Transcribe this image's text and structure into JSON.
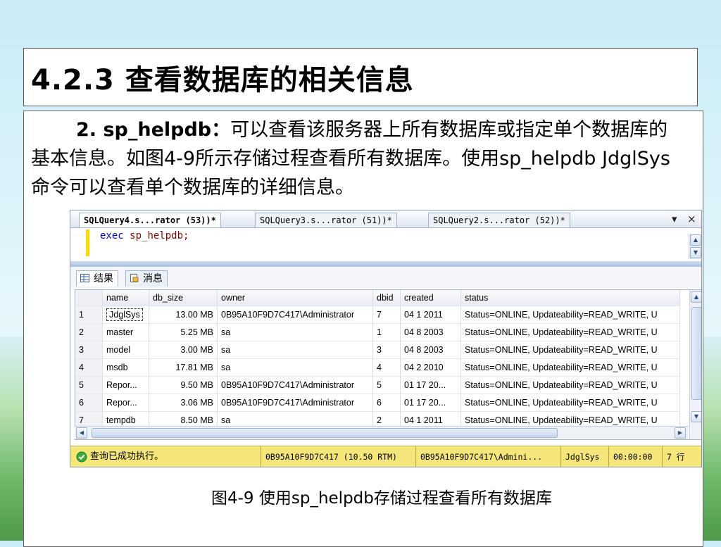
{
  "slide": {
    "title": "4.2.3  查看数据库的相关信息",
    "para_lead": "2. sp_helpdb：",
    "para_text": "可以查看该服务器上所有数据库或指定单个数据库的基本信息。如图4-9所示存储过程查看所有数据库。使用sp_helpdb JdglSys命令可以查看单个数据库的详细信息。",
    "caption": "图4-9  使用sp_helpdb存储过程查看所有数据库"
  },
  "ssms": {
    "tabs": [
      {
        "label": "SQLQuery4.s...rator (53))*"
      },
      {
        "label": "SQLQuery3.s...rator (51))*"
      },
      {
        "label": "SQLQuery2.s...rator (52))*"
      }
    ],
    "tab_dropdown": "▾",
    "tab_close": "×",
    "code": {
      "keyword": "exec",
      "proc": "sp_helpdb;"
    },
    "result_tabs": [
      {
        "label": "结果"
      },
      {
        "label": "消息"
      }
    ],
    "columns": [
      "name",
      "db_size",
      "owner",
      "dbid",
      "created",
      "status"
    ],
    "rows": [
      {
        "n": "1",
        "name": "JdglSys",
        "db_size": "13.00 MB",
        "owner": "0B95A10F9D7C417\\Administrator",
        "dbid": "7",
        "created": "04  1 2011",
        "status": "Status=ONLINE, Updateability=READ_WRITE, U"
      },
      {
        "n": "2",
        "name": "master",
        "db_size": "5.25 MB",
        "owner": "sa",
        "dbid": "1",
        "created": "04  8 2003",
        "status": "Status=ONLINE, Updateability=READ_WRITE, U"
      },
      {
        "n": "3",
        "name": "model",
        "db_size": "3.00 MB",
        "owner": "sa",
        "dbid": "3",
        "created": "04  8 2003",
        "status": "Status=ONLINE, Updateability=READ_WRITE, U"
      },
      {
        "n": "4",
        "name": "msdb",
        "db_size": "17.81 MB",
        "owner": "sa",
        "dbid": "4",
        "created": "04  2 2010",
        "status": "Status=ONLINE, Updateability=READ_WRITE, U"
      },
      {
        "n": "5",
        "name": "Repor...",
        "db_size": "9.50 MB",
        "owner": "0B95A10F9D7C417\\Administrator",
        "dbid": "5",
        "created": "01 17 20...",
        "status": "Status=ONLINE, Updateability=READ_WRITE, U"
      },
      {
        "n": "6",
        "name": "Repor...",
        "db_size": "3.06 MB",
        "owner": "0B95A10F9D7C417\\Administrator",
        "dbid": "6",
        "created": "01 17 20...",
        "status": "Status=ONLINE, Updateability=READ_WRITE, U"
      },
      {
        "n": "7",
        "name": "tempdb",
        "db_size": "8.50 MB",
        "owner": "sa",
        "dbid": "2",
        "created": "04  1 2011",
        "status": "Status=ONLINE, Updateability=READ_WRITE, U"
      }
    ],
    "status_bar": {
      "message": "查询已成功执行。",
      "server": "0B95A10F9D7C417 (10.50 RTM)",
      "login": "0B95A10F9D7C417\\Admini...",
      "database": "JdglSys",
      "elapsed": "00:00:00",
      "rows": "7 行"
    }
  },
  "colors": {
    "accent": "#ffd700",
    "status_bar": "#f5e67a",
    "keyword": "#0000d0",
    "proc": "#8b0000"
  }
}
